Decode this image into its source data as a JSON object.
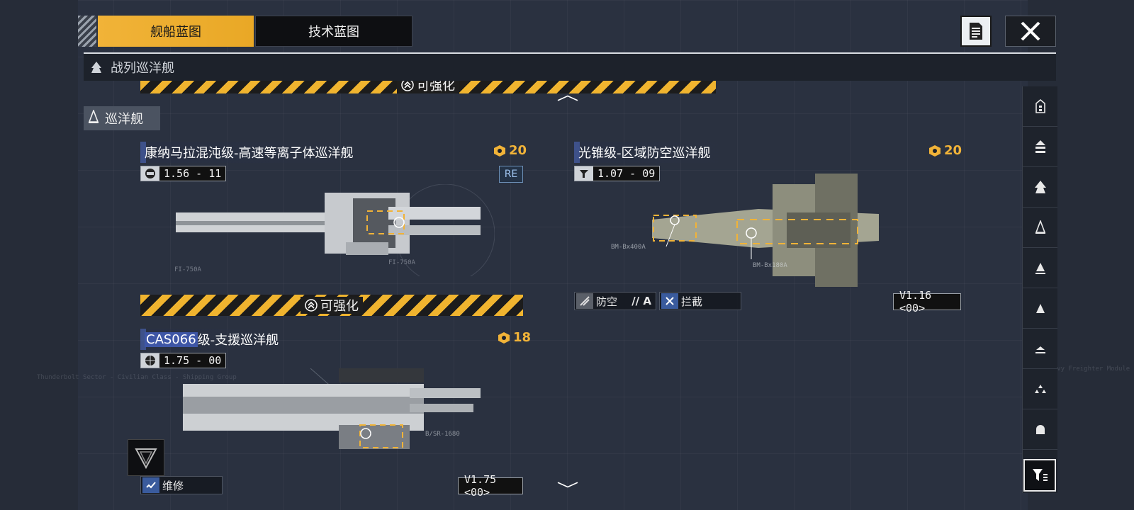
{
  "tabs": {
    "active": "舰船蓝图",
    "inactive": "技术蓝图"
  },
  "category": {
    "title": "战列巡洋舰"
  },
  "partial_card": {
    "upgrade_label": "可强化"
  },
  "subcategory": {
    "title": "巡洋舰"
  },
  "cards": [
    {
      "name_prefix": "",
      "name_highlight": "",
      "name": "康纳马拉混沌级-高速等离子体巡洋舰",
      "cost": "20",
      "version": "1.56 - 11",
      "badge": "RE",
      "upgrade_label": "可强化"
    },
    {
      "name": "光锥级-区域防空巡洋舰",
      "cost": "20",
      "version": "1.07 - 09",
      "tag1": {
        "label": "防空",
        "suffix": "// A"
      },
      "tag2": {
        "label": "拦截"
      },
      "vbadge": "V1.16 <00>",
      "callouts": [
        "BM-Bx400A",
        "BM-Bx180A"
      ]
    },
    {
      "name_highlight": "CAS066",
      "name_rest": "级-支援巡洋舰",
      "cost": "18",
      "version": "1.75 - 00",
      "tag1": {
        "label": "维修"
      },
      "vbadge": "V1.75 <00>",
      "callouts": [
        "B/SR-1680"
      ]
    }
  ],
  "card1_callouts": [
    "FI-750A",
    "FI-750A"
  ],
  "icons": {
    "doc": "document-icon",
    "close": "close-icon",
    "filter": "filter-icon",
    "sidenav": [
      "carrier-icon",
      "battleship-icon",
      "battlecruiser-icon",
      "cruiser-icon",
      "destroyer-icon",
      "frigate-icon",
      "corvette-icon",
      "fighter-group-icon",
      "auxiliary-icon"
    ]
  },
  "colors": {
    "accent": "#f1b338",
    "background": "#2a3140",
    "highlight": "#3e56a6"
  }
}
